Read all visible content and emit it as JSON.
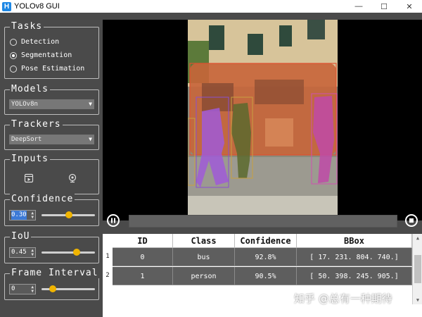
{
  "window": {
    "title": "YOLOv8 GUI",
    "icon_letter": "H",
    "min": "—",
    "max": "☐",
    "close": "✕"
  },
  "tasks": {
    "title": "Tasks",
    "options": [
      {
        "label": "Detection",
        "selected": false
      },
      {
        "label": "Segmentation",
        "selected": true
      },
      {
        "label": "Pose Estimation",
        "selected": false
      }
    ]
  },
  "models": {
    "title": "Models",
    "selected": "YOLOv8n"
  },
  "trackers": {
    "title": "Trackers",
    "selected": "DeepSort"
  },
  "inputs": {
    "title": "Inputs",
    "icons": [
      "video-file-icon",
      "webcam-icon"
    ]
  },
  "confidence": {
    "title": "Confidence",
    "value": "0.30",
    "slider_fraction": 0.3
  },
  "iou": {
    "title": "IoU",
    "value": "0.45",
    "slider_fraction": 0.45
  },
  "frame_interval": {
    "title": "Frame Interval",
    "value": "0",
    "slider_fraction": 0.0
  },
  "playback": {
    "play_icon": "pause-icon",
    "stop_icon": "stop-icon"
  },
  "table": {
    "columns": [
      "ID",
      "Class",
      "Confidence",
      "BBox"
    ],
    "rows": [
      {
        "num": "1",
        "id": "0",
        "class": "bus",
        "confidence": "92.8%",
        "bbox": "[ 17. 231. 804. 740.]"
      },
      {
        "num": "2",
        "id": "1",
        "class": "person",
        "confidence": "90.5%",
        "bbox": "[ 50. 398. 245. 905.]"
      }
    ]
  },
  "watermark": "知乎 @总有一种期待",
  "colors": {
    "accent": "#f0b400",
    "panel": "#4a4a4a",
    "selection": "#3d7ad6"
  }
}
